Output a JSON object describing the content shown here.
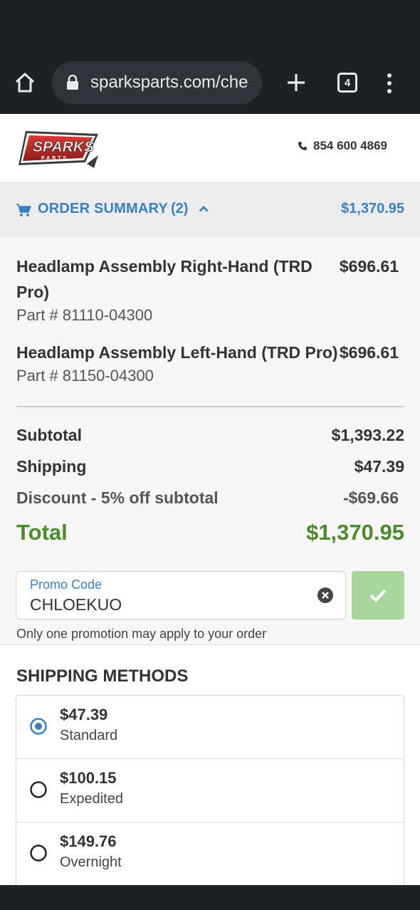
{
  "browser": {
    "url": "sparksparts.com/che",
    "tab_count": "4"
  },
  "site": {
    "logo_text": "SPARKS",
    "logo_subtext": "PARTS",
    "phone": "854 600 4869"
  },
  "summary_bar": {
    "label": "ORDER SUMMARY",
    "count": "(2)",
    "total": "$1,370.95"
  },
  "items": [
    {
      "name": "Headlamp Assembly Right-Hand (TRD Pro)",
      "price": "$696.61",
      "part": "Part # 81110-04300"
    },
    {
      "name": "Headlamp Assembly Left-Hand (TRD Pro)",
      "price": "$696.61",
      "part": "Part # 81150-04300"
    }
  ],
  "totals": {
    "subtotal_label": "Subtotal",
    "subtotal_value": "$1,393.22",
    "shipping_label": "Shipping",
    "shipping_value": "$47.39",
    "discount_label": "Discount - 5% off subtotal",
    "discount_value": "-$69.66",
    "total_label": "Total",
    "total_value": "$1,370.95"
  },
  "promo": {
    "label": "Promo Code",
    "value": "CHLOEKUO",
    "note": "Only one promotion may apply to your order"
  },
  "shipping": {
    "title": "SHIPPING METHODS",
    "options": [
      {
        "price": "$47.39",
        "name": "Standard",
        "selected": true
      },
      {
        "price": "$100.15",
        "name": "Expedited",
        "selected": false
      },
      {
        "price": "$149.76",
        "name": "Overnight",
        "selected": false
      }
    ]
  },
  "colors": {
    "accent_blue": "#3a7fc1",
    "total_green": "#4c8b2b",
    "apply_green": "#a8d69c"
  }
}
